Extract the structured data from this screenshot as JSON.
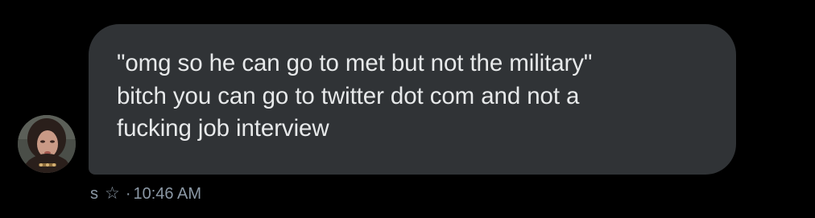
{
  "message": {
    "lines": [
      "\"omg so he can go to met but not the military\"",
      "bitch you can go to twitter dot com and not a",
      "fucking job interview"
    ]
  },
  "meta": {
    "sender_initial": "s",
    "star_icon": "☆",
    "separator": "·",
    "timestamp": "10:46 AM"
  },
  "colors": {
    "background": "#000000",
    "bubble": "#303336",
    "message_text": "#e7e9ea",
    "meta_text": "#8b98a5"
  },
  "icons": {
    "reaction": "star-outline-icon",
    "avatar": "profile-avatar"
  }
}
